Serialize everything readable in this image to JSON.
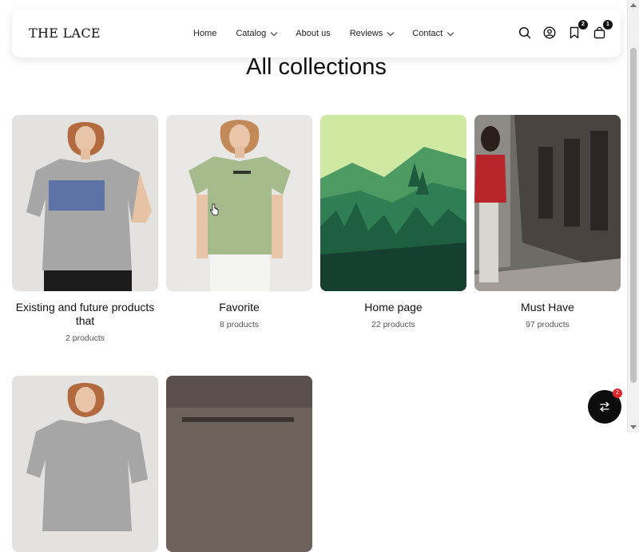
{
  "header": {
    "logo": "THE LACE",
    "nav": [
      {
        "label": "Home",
        "has_dropdown": false
      },
      {
        "label": "Catalog",
        "has_dropdown": true
      },
      {
        "label": "About us",
        "has_dropdown": false
      },
      {
        "label": "Reviews",
        "has_dropdown": true
      },
      {
        "label": "Contact",
        "has_dropdown": true
      }
    ],
    "icons": {
      "search": "search-icon",
      "account": "user-icon",
      "wishlist": "bookmark-icon",
      "cart": "bag-icon"
    },
    "wishlist_count": "2",
    "cart_count": "1"
  },
  "page": {
    "title": "All collections"
  },
  "collections": [
    {
      "name": "Existing and future products that",
      "count": "2 products"
    },
    {
      "name": "Favorite",
      "count": "8 products"
    },
    {
      "name": "Home page",
      "count": "22 products"
    },
    {
      "name": "Must Have",
      "count": "97 products"
    }
  ],
  "floating_button": {
    "icon": "swap-icon",
    "badge": "2"
  },
  "colors": {
    "accent": "#111111",
    "badge_red": "#e0262b"
  }
}
